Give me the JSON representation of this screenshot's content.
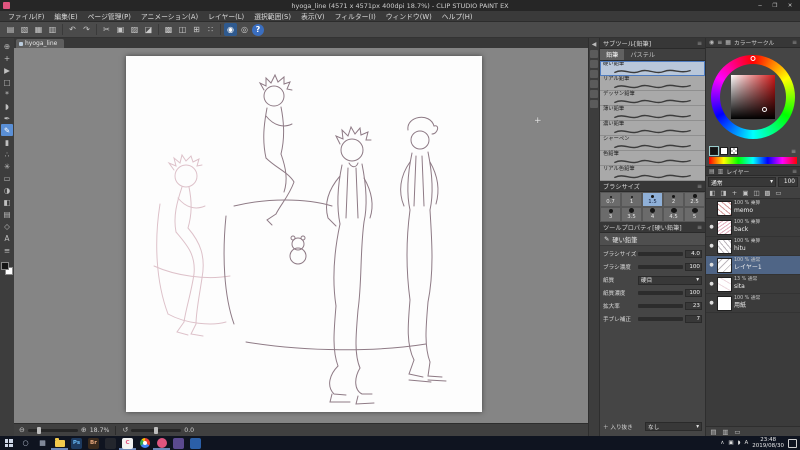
{
  "window": {
    "title": "hyoga_line (4571 x 4571px 400dpi 18.7%) - CLIP STUDIO PAINT EX"
  },
  "glyphs": {
    "minimize": "─",
    "maximize": "❐",
    "close": "✕",
    "chevron_down": "▾",
    "menu": "≡",
    "eye": "●",
    "collapse_left": "◀",
    "zoom_out": "⊖",
    "zoom_in": "⊕",
    "rotate": "↺",
    "tray_up": "∧",
    "tray_net": "▣",
    "tray_sound": "◗",
    "crosshair": "+"
  },
  "menu": {
    "items": [
      "ファイル(F)",
      "編集(E)",
      "ページ管理(P)",
      "アニメーション(A)",
      "レイヤー(L)",
      "選択範囲(S)",
      "表示(V)",
      "フィルター(I)",
      "ウィンドウ(W)",
      "ヘルプ(H)"
    ]
  },
  "toolbar_icons": [
    {
      "glyph": "▤"
    },
    {
      "glyph": "▧"
    },
    {
      "glyph": "▦"
    },
    {
      "glyph": "▥"
    },
    {
      "glyph": "↶"
    },
    {
      "glyph": "↷"
    },
    {
      "glyph": "✂"
    },
    {
      "glyph": "▣"
    },
    {
      "glyph": "▨"
    },
    {
      "glyph": "◪"
    },
    {
      "glyph": "▩"
    },
    {
      "glyph": "◫"
    },
    {
      "glyph": "⊞"
    },
    {
      "glyph": "∷"
    },
    {
      "glyph": "◉"
    },
    {
      "glyph": "◎"
    },
    {
      "glyph": "?"
    }
  ],
  "left_tools": [
    {
      "glyph": "⊕"
    },
    {
      "glyph": "+"
    },
    {
      "glyph": "▶"
    },
    {
      "glyph": "□"
    },
    {
      "glyph": "*"
    },
    {
      "glyph": "◗"
    },
    {
      "glyph": "✒"
    },
    {
      "glyph": "✎"
    },
    {
      "glyph": "▮"
    },
    {
      "glyph": "∴"
    },
    {
      "glyph": "✳"
    },
    {
      "glyph": "▭"
    },
    {
      "glyph": "◑"
    },
    {
      "glyph": "◧"
    },
    {
      "glyph": "▤"
    },
    {
      "glyph": "◇"
    },
    {
      "glyph": "A"
    },
    {
      "glyph": "≡"
    }
  ],
  "document": {
    "tab": "hyoga_line"
  },
  "statusbar": {
    "zoom": "18.7%",
    "rotation": "0.0"
  },
  "subtool_panel": {
    "title": "サブツール[鉛筆]",
    "tabs": [
      {
        "label": "鉛筆"
      },
      {
        "label": "パステル"
      }
    ],
    "brushes": [
      {
        "name": "硬い鉛筆"
      },
      {
        "name": "リアル鉛筆"
      },
      {
        "name": "デッサン鉛筆"
      },
      {
        "name": "薄い鉛筆"
      },
      {
        "name": "濃い鉛筆"
      },
      {
        "name": "シャーペン"
      },
      {
        "name": "色鉛筆"
      },
      {
        "name": "リアル色鉛筆"
      }
    ]
  },
  "brush_size_panel": {
    "title": "ブラシサイズ",
    "presets": [
      "0.7",
      "1",
      "1.5",
      "2",
      "2.5",
      "3",
      "3.5",
      "4",
      "4.5",
      "5"
    ]
  },
  "tool_property_panel": {
    "title": "ツールプロパティ[硬い鉛筆]",
    "subtool_name": "硬い鉛筆",
    "rows": [
      {
        "label": "ブラシサイズ",
        "value": "4.0"
      },
      {
        "label": "ブラシ濃度",
        "value": "100"
      },
      {
        "label": "紙質",
        "value": "硬目"
      },
      {
        "label": "紙質濃度",
        "value": "100"
      },
      {
        "label": "拡大率",
        "value": "23"
      },
      {
        "label": "手ブレ補正",
        "value": "7"
      }
    ],
    "footer": {
      "label": "＋ 入り抜き",
      "value": "なし"
    }
  },
  "color_panel": {
    "title": "カラーサークル"
  },
  "layer_panel": {
    "title": "レイヤー",
    "blend_mode": "通常",
    "opacity": "100",
    "layers": [
      {
        "info": "100 % 乗算",
        "name": "memo",
        "eye": ""
      },
      {
        "info": "100 % 乗算",
        "name": "back",
        "eye": "●"
      },
      {
        "info": "100 % 乗算",
        "name": "hitu",
        "eye": "●"
      },
      {
        "info": "100 % 通常",
        "name": "レイヤー1",
        "eye": "●"
      },
      {
        "info": "13 % 通常",
        "name": "sita",
        "eye": "●"
      },
      {
        "info": "100 % 通常",
        "name": "用紙",
        "eye": "●"
      }
    ]
  },
  "taskbar": {
    "apps": [
      {
        "label": ""
      },
      {
        "label": "Ps"
      },
      {
        "label": "Br"
      },
      {
        "label": ""
      },
      {
        "label": "C"
      },
      {
        "label": ""
      },
      {
        "label": ""
      },
      {
        "label": ""
      },
      {
        "label": ""
      }
    ],
    "ime": "A",
    "time": "23:48",
    "date": "2019/08/30"
  },
  "colors": {
    "accent_blue": "#5a8fd6",
    "selection_blue": "#4f6586",
    "taskbar_bg": "#0f1420",
    "canvas_white": "#fdfdfd",
    "brand_pink": "#e0557f"
  }
}
